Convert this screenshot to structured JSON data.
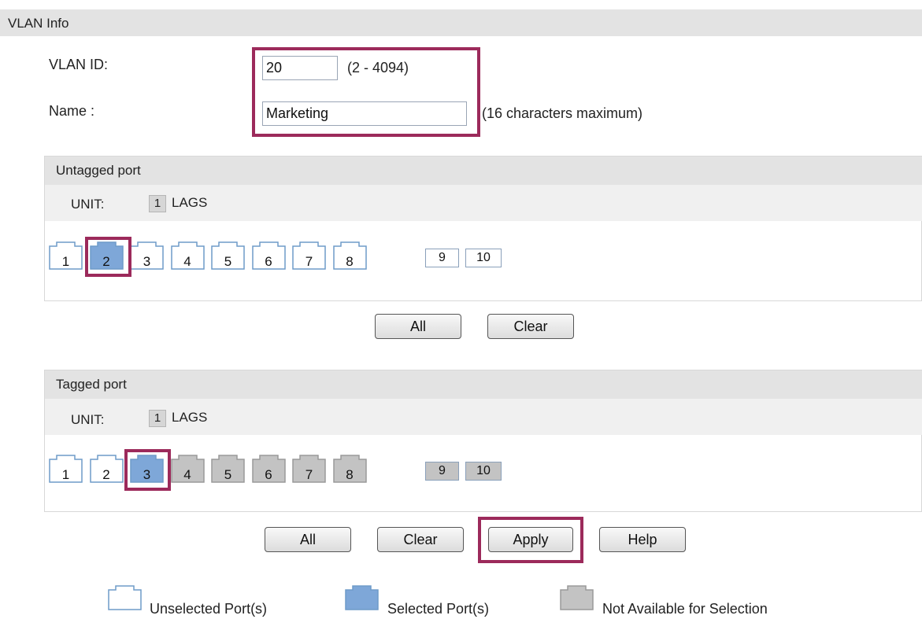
{
  "header": {
    "title": "VLAN Info"
  },
  "form": {
    "vlan_id_label": "VLAN ID:",
    "vlan_id_value": "20",
    "vlan_id_range": "(2 - 4094)",
    "name_label": "Name :",
    "name_value": "Marketing",
    "name_hint": "(16 characters maximum)"
  },
  "untagged": {
    "title": "Untagged port",
    "unit_label": "UNIT:",
    "unit_value": "1",
    "lags_label": "LAGS",
    "ports": [
      {
        "num": "1",
        "state": "unselected"
      },
      {
        "num": "2",
        "state": "selected"
      },
      {
        "num": "3",
        "state": "unselected"
      },
      {
        "num": "4",
        "state": "unselected"
      },
      {
        "num": "5",
        "state": "unselected"
      },
      {
        "num": "6",
        "state": "unselected"
      },
      {
        "num": "7",
        "state": "unselected"
      },
      {
        "num": "8",
        "state": "unselected"
      }
    ],
    "sfp": [
      {
        "num": "9",
        "state": "unselected"
      },
      {
        "num": "10",
        "state": "unselected"
      }
    ],
    "all_label": "All",
    "clear_label": "Clear"
  },
  "tagged": {
    "title": "Tagged port",
    "unit_label": "UNIT:",
    "unit_value": "1",
    "lags_label": "LAGS",
    "ports": [
      {
        "num": "1",
        "state": "unselected"
      },
      {
        "num": "2",
        "state": "unselected"
      },
      {
        "num": "3",
        "state": "selected"
      },
      {
        "num": "4",
        "state": "na"
      },
      {
        "num": "5",
        "state": "na"
      },
      {
        "num": "6",
        "state": "na"
      },
      {
        "num": "7",
        "state": "na"
      },
      {
        "num": "8",
        "state": "na"
      }
    ],
    "sfp": [
      {
        "num": "9",
        "state": "na"
      },
      {
        "num": "10",
        "state": "na"
      }
    ]
  },
  "actions": {
    "all_label": "All",
    "clear_label": "Clear",
    "apply_label": "Apply",
    "help_label": "Help"
  },
  "legend": {
    "unselected": "Unselected Port(s)",
    "selected": "Selected Port(s)",
    "na": "Not Available for Selection"
  },
  "colors": {
    "highlight": "#9c2a5b",
    "selected_fill": "#7ea7d8",
    "na_fill": "#c3c3c3",
    "port_outline": "#6f9cc9"
  }
}
